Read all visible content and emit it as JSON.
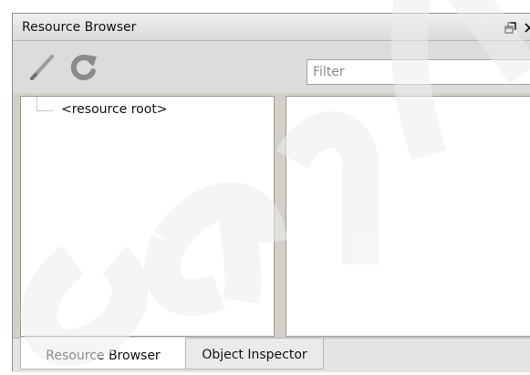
{
  "window": {
    "title": "Resource Browser"
  },
  "title_controls": {
    "restore_icon": "restore-window-icon",
    "close_icon": "close-icon"
  },
  "toolbar": {
    "edit_icon": "pencil-icon",
    "refresh_icon": "refresh-icon",
    "filter_placeholder": "Filter",
    "filter_value": ""
  },
  "tree": {
    "items": [
      {
        "label": "<resource root>"
      }
    ]
  },
  "list": {
    "items": []
  },
  "tabs": [
    {
      "label": "Resource Browser",
      "active": true
    },
    {
      "label": "Object Inspector",
      "active": false
    }
  ],
  "colors": {
    "window_background": "#d4d0c8",
    "pane_background": "#ffffff",
    "pane_border": "#9b9b9b",
    "title_gradient_top": "#f0f0f0",
    "title_gradient_bottom": "#dadada",
    "watermark": "#e8e8e8"
  }
}
